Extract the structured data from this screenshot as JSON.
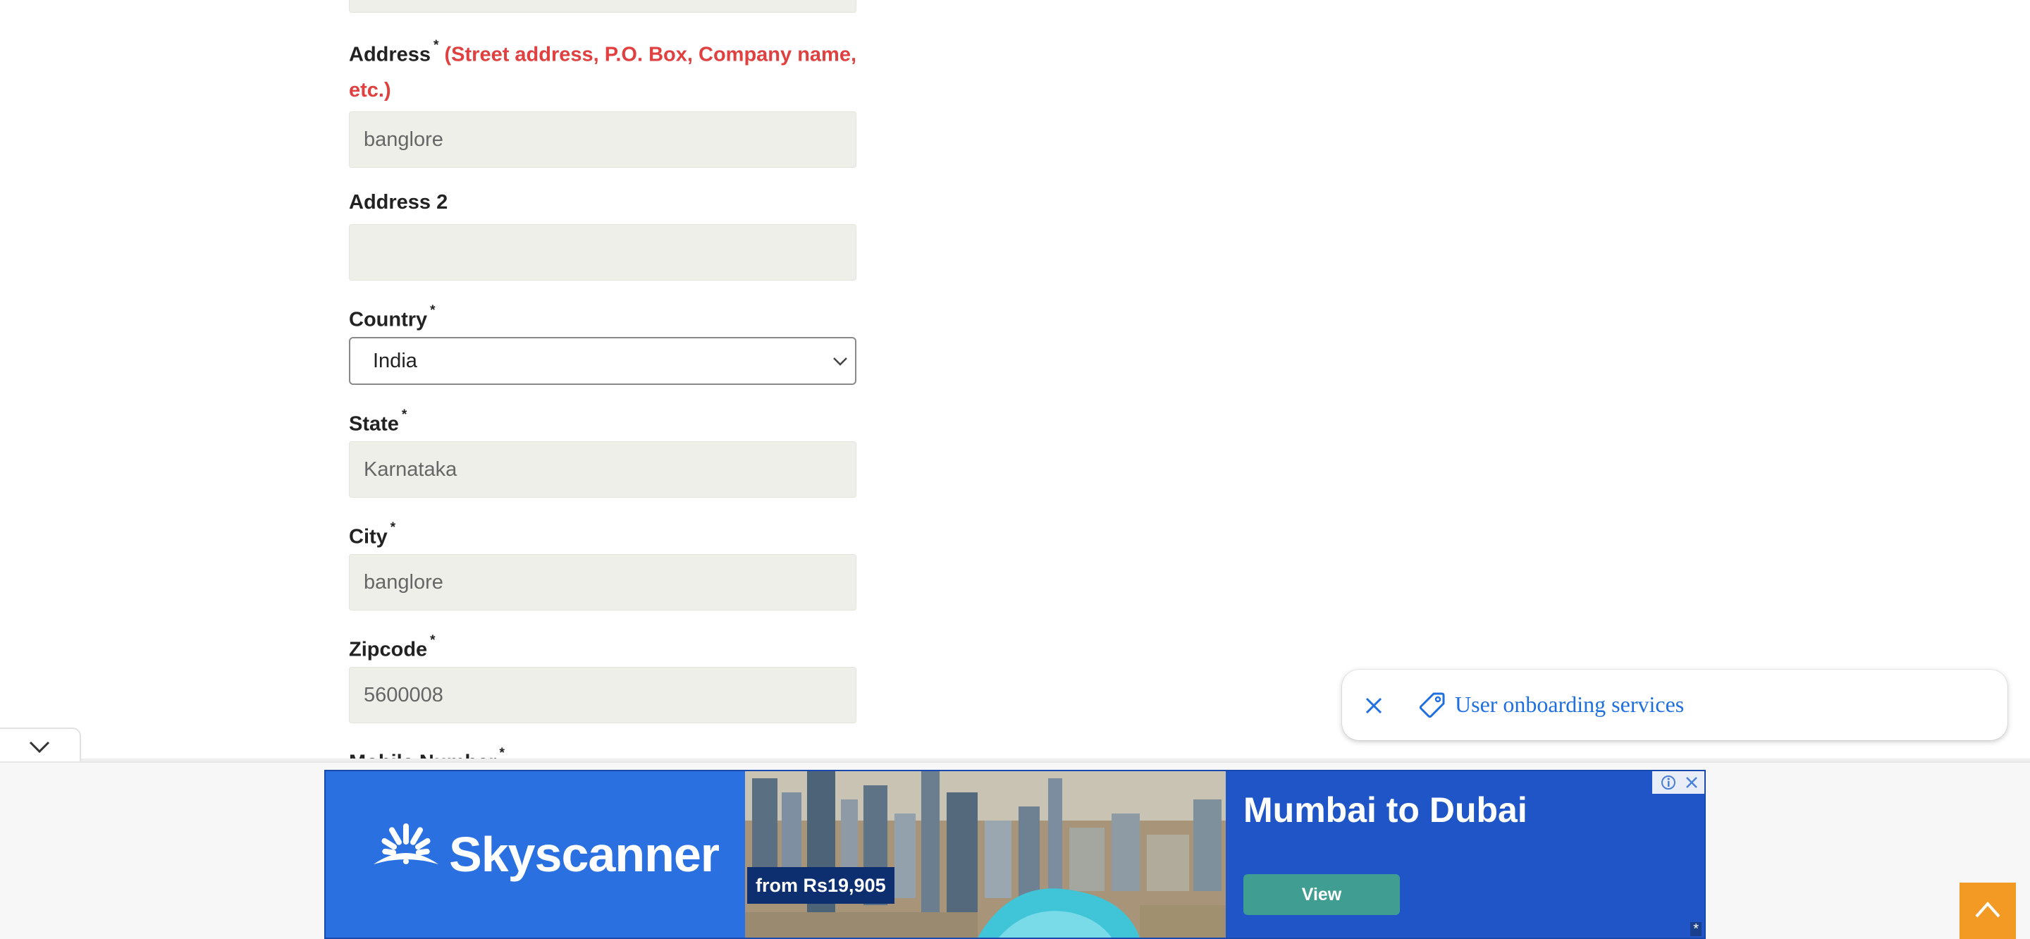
{
  "form": {
    "address": {
      "label": "Address",
      "required_mark": "*",
      "hint": "(Street address, P.O. Box, Company name, etc.)",
      "value": "banglore"
    },
    "address2": {
      "label": "Address 2",
      "value": ""
    },
    "country": {
      "label": "Country",
      "required_mark": "*",
      "selected": "India"
    },
    "state": {
      "label": "State",
      "required_mark": "*",
      "value": "Karnataka"
    },
    "city": {
      "label": "City",
      "required_mark": "*",
      "value": "banglore"
    },
    "zipcode": {
      "label": "Zipcode",
      "required_mark": "*",
      "value": "5600008"
    },
    "mobile": {
      "label": "Mobile Number",
      "required_mark": "*"
    }
  },
  "toast": {
    "text": "User onboarding services",
    "color": "#1f6fe0"
  },
  "ad": {
    "brand": "Skyscanner",
    "price": "from Rs19,905",
    "headline": "Mumbai to Dubai",
    "cta": "View",
    "corner_mark": "*",
    "colors": {
      "background": "#1f55c6",
      "brand_panel": "#2a70e0",
      "button": "#3f9d92"
    }
  },
  "icons": {
    "collapse": "chevron-down-icon",
    "toast_close": "close-icon",
    "toast_tag": "tag-icon",
    "back_to_top": "chevron-up-icon",
    "ad_info": "ad-choices-icon",
    "ad_close": "close-icon"
  },
  "accent": {
    "required_hint": "#e04040",
    "back_to_top": "#f39a24"
  }
}
